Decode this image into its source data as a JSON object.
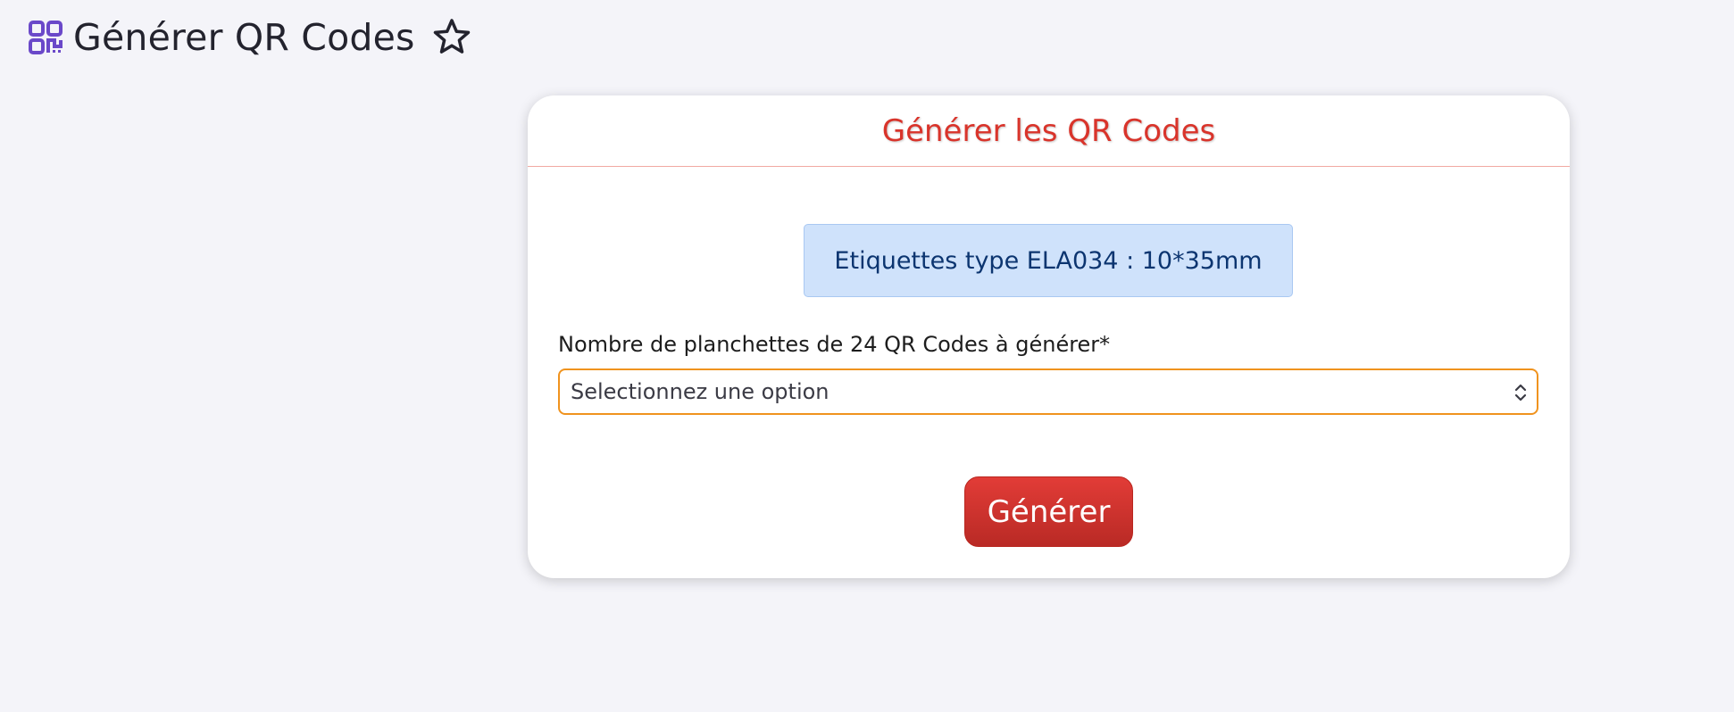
{
  "header": {
    "title": "Générer QR Codes",
    "icon": "qr-code-icon",
    "favorite_icon": "star-outline-icon"
  },
  "card": {
    "title": "Générer les QR Codes",
    "info": "Etiquettes type ELA034 : 10*35mm",
    "field_label": "Nombre de planchettes de 24 QR Codes à générer*",
    "select_placeholder": "Selectionnez une option",
    "button_label": "Générer"
  },
  "colors": {
    "icon_purple": "#6a48c9",
    "accent_red": "#d9342b",
    "select_border_orange": "#f0931e",
    "info_bg": "#cfe2fb",
    "page_bg": "#f4f4f9"
  }
}
